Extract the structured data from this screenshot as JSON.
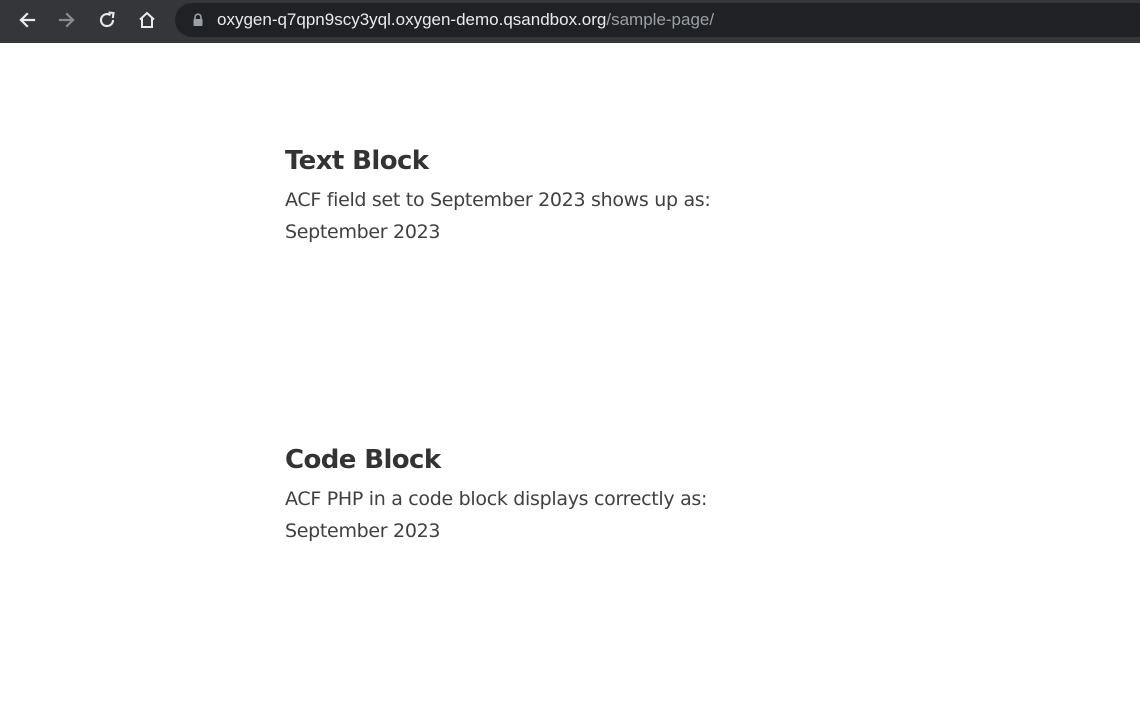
{
  "browser": {
    "url_host": "oxygen-q7qpn9scy3yql.oxygen-demo.qsandbox.org",
    "url_path": "/sample-page/",
    "icons": {
      "back": "arrow-left-icon",
      "forward": "arrow-right-icon",
      "reload": "reload-icon",
      "home": "home-icon",
      "lock": "lock-icon"
    },
    "colors": {
      "toolbar": "#35363a",
      "omnibox": "#202124",
      "url_host": "#e8eaed",
      "url_path": "#9aa0a6"
    }
  },
  "page": {
    "text_block": {
      "heading": "Text Block",
      "description": "ACF field set to September 2023 shows up as:",
      "value": "September 2023"
    },
    "code_block": {
      "heading": "Code Block",
      "description": "ACF PHP in a code block displays correctly as:",
      "value": "September 2023"
    }
  }
}
